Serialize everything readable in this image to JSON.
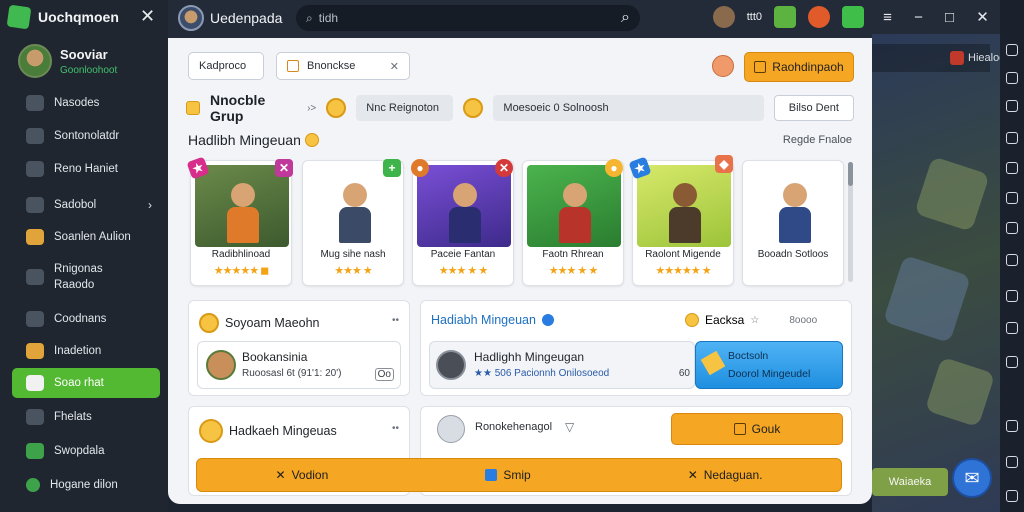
{
  "app": {
    "brand": "Uochqmoen",
    "close_icon": "close-icon"
  },
  "profile": {
    "name": "Sooviar",
    "status": "Goonloohoot"
  },
  "sidebar": {
    "items": [
      {
        "label": "Nasodes",
        "icon": "user-icon"
      },
      {
        "label": "Sontonolatdr",
        "icon": "smiley-icon"
      },
      {
        "label": "Reno Haniet",
        "icon": "list-icon"
      },
      {
        "label": "Sadobol",
        "icon": "chat-icon",
        "chevron": "›"
      },
      {
        "label": "Soanlen Aulion",
        "icon": "trophy-icon"
      },
      {
        "label": "Rnigonas",
        "sub": "Raaodo",
        "icon": "screen-icon"
      },
      {
        "label": "Coodnans",
        "icon": "mail-icon"
      },
      {
        "label": "Inadetion",
        "icon": "tool-icon"
      },
      {
        "label": "Soao rhat",
        "icon": "save-icon",
        "active": true
      },
      {
        "label": "Fhelats",
        "icon": "settings-icon"
      },
      {
        "label": "Swopdala",
        "icon": "group-icon"
      },
      {
        "label": "Hogane dilon",
        "icon": "green-dot-icon"
      }
    ]
  },
  "topbar": {
    "title": "Uedenpada",
    "search_placeholder": "tidh",
    "value": "ttt0"
  },
  "window_controls": [
    "≡",
    "−",
    "□",
    "✕"
  ],
  "panel": {
    "chip_left": "Kadproco",
    "chip_mid": "Bnonckse",
    "avatar_btn": "",
    "primary_btn": "Raohdinpaoh",
    "group_title": "Nnocble Grup",
    "group_sep": "›>",
    "group_pill_1": "Nnc Reignoton",
    "group_pill_2": "Moesoeic 0 Solnoosh",
    "group_btn": "Bilso Dent",
    "section_title": "Hadlibh Mingeuan",
    "see_all": "Regde Fnaloe",
    "cards": [
      {
        "name": "Radibhlinoad",
        "stars": "★★★★★ ◼"
      },
      {
        "name": "Mug sihe nash",
        "stars": "★★★ ★"
      },
      {
        "name": "Paceie Fantan",
        "stars": "★★★ ★ ★"
      },
      {
        "name": "Faotn Rhrean",
        "stars": "★★★ ★ ★"
      },
      {
        "name": "Raolont Migende",
        "stars": "★★★★★ ★"
      },
      {
        "name": "Booadn Sotloos",
        "stars": ""
      }
    ],
    "box1": {
      "title": "Soyoam Maeohn",
      "row_title": "Bookansinia",
      "row_sub": "Ruoosasl 6t (91'1: 20')",
      "row_tag": "Oo"
    },
    "box2": {
      "title": "Hadiabh Mingeuan",
      "right_label": "Eacksa",
      "right_sub": "☆",
      "right_count": "8oooo",
      "row_title": "Hadlighh Mingeugan",
      "row_sub": "★★ 506 Pacionnh Onilosoeod",
      "row_tag": "60",
      "tile_title": "Boctsoln",
      "tile_sub": "Doorol Mingeudel"
    },
    "box3": {
      "title": "Hadkaeh Mingeuas"
    },
    "box4": {
      "row_title": "Ronokehenagol",
      "btn": "Gouk"
    },
    "actions": [
      "Vodion",
      "Smip",
      "Nedaguan."
    ]
  },
  "background": {
    "header": "Hiealoe",
    "tag_button": "Waiaeka"
  }
}
